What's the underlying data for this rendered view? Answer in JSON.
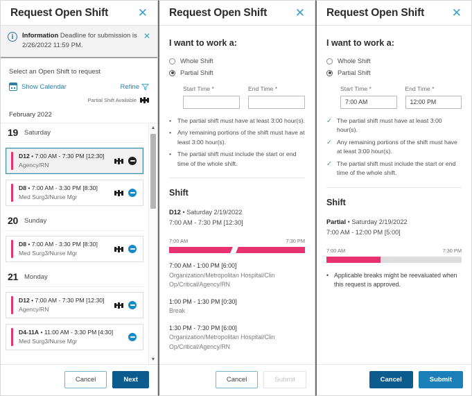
{
  "panel1": {
    "title": "Request Open Shift",
    "close_icon": "close-icon",
    "banner": {
      "strong": "Information",
      "text": " Deadline for submission is 2/26/2022 11:59 PM.",
      "close_icon": "close-icon"
    },
    "select_label": "Select an Open Shift to request",
    "show_calendar": "Show Calendar",
    "refine": "Refine",
    "legend": "Partial Shift Available",
    "month": "February 2022",
    "days": [
      {
        "num": "19",
        "name": "Saturday",
        "shifts": [
          {
            "code": "D12",
            "time": "7:00 AM - 7:30 PM [12:30]",
            "unit": "Agency/RN",
            "selected": true,
            "partial_icon": true,
            "badge": "minus-badge-dark"
          },
          {
            "code": "D8",
            "time": "7:00 AM - 3:30 PM [8:30]",
            "unit": "Med Surg3/Nurse Mgr",
            "selected": false,
            "partial_icon": true,
            "badge": "minus-badge-blue"
          }
        ]
      },
      {
        "num": "20",
        "name": "Sunday",
        "shifts": [
          {
            "code": "D8",
            "time": "7:00 AM - 3:30 PM [8:30]",
            "unit": "Med Surg3/Nurse Mgr",
            "selected": false,
            "partial_icon": true,
            "badge": "minus-badge-blue"
          }
        ]
      },
      {
        "num": "21",
        "name": "Monday",
        "shifts": [
          {
            "code": "D12",
            "time": "7:00 AM - 7:30 PM [12:30]",
            "unit": "Agency/RN",
            "selected": false,
            "partial_icon": true,
            "badge": "minus-badge-blue"
          },
          {
            "code": "D4-11A",
            "time": "11:00 AM - 3:30 PM [4:30]",
            "unit": "Med Surg3/Nurse Mgr",
            "selected": false,
            "partial_icon": false,
            "badge": "minus-badge-blue"
          }
        ]
      }
    ],
    "footer": {
      "cancel": "Cancel",
      "next": "Next"
    }
  },
  "panel2": {
    "title": "Request Open Shift",
    "close_icon": "close-icon",
    "section_title": "I want to work a:",
    "radio_whole": "Whole Shift",
    "radio_partial": "Partial Shift",
    "start_label": "Start Time *",
    "end_label": "End Time *",
    "start_value": "",
    "end_value": "",
    "start_placeholder": "",
    "end_placeholder": "",
    "rules": [
      "The partial shift must have at least 3:00 hour(s).",
      "Any remaining portions of the shift must have at least 3:00 hour(s).",
      "The partial shift must include the start or end time of the whole shift."
    ],
    "shift_heading": "Shift",
    "shift_code": "D12",
    "shift_date": " • Saturday 2/19/2022",
    "shift_range": "7:00 AM - 7:30 PM [12:30]",
    "tl_start": "7:00 AM",
    "tl_end": "7:30 PM",
    "segments": [
      {
        "time": "7:00 AM - 1:00 PM [6:00]",
        "desc": "Organization/Metropolitan Hospital/Clin Op/Critical/Agency/RN"
      },
      {
        "time": "1:00 PM - 1:30 PM [0:30]",
        "desc": "Break"
      },
      {
        "time": "1:30 PM - 7:30 PM [6:00]",
        "desc": "Organization/Metropolitan Hospital/Clin Op/Critical/Agency/RN"
      }
    ],
    "footer": {
      "cancel": "Cancel",
      "submit": "Submit"
    }
  },
  "panel3": {
    "title": "Request Open Shift",
    "close_icon": "close-icon",
    "section_title": "I want to work a:",
    "radio_whole": "Whole Shift",
    "radio_partial": "Partial Shift",
    "start_label": "Start Time *",
    "end_label": "End Time *",
    "start_value": "7:00 AM",
    "end_value": "12:00 PM",
    "rules": [
      "The partial shift must have at least 3:00 hour(s).",
      "Any remaining portions of the shift must have at least 3:00 hour(s).",
      "The partial shift must include the start or end time of the whole shift."
    ],
    "shift_heading": "Shift",
    "shift_code": "Partial",
    "shift_date": " • Saturday 2/19/2022",
    "shift_range": "7:00 AM - 12:00 PM [5:00]",
    "tl_start": "7:00 AM",
    "tl_end": "7:30 PM",
    "note": "Applicable breaks might be reevaluated when this request is approved.",
    "footer": {
      "cancel": "Cancel",
      "submit": "Submit"
    }
  },
  "colors": {
    "accent_pink": "#e8316f",
    "link_blue": "#2d7fa8",
    "primary_blue": "#0b5b8e",
    "submit_blue": "#1b7fb8",
    "check_green": "#3aa05a",
    "info_blue": "#2e6fae"
  }
}
